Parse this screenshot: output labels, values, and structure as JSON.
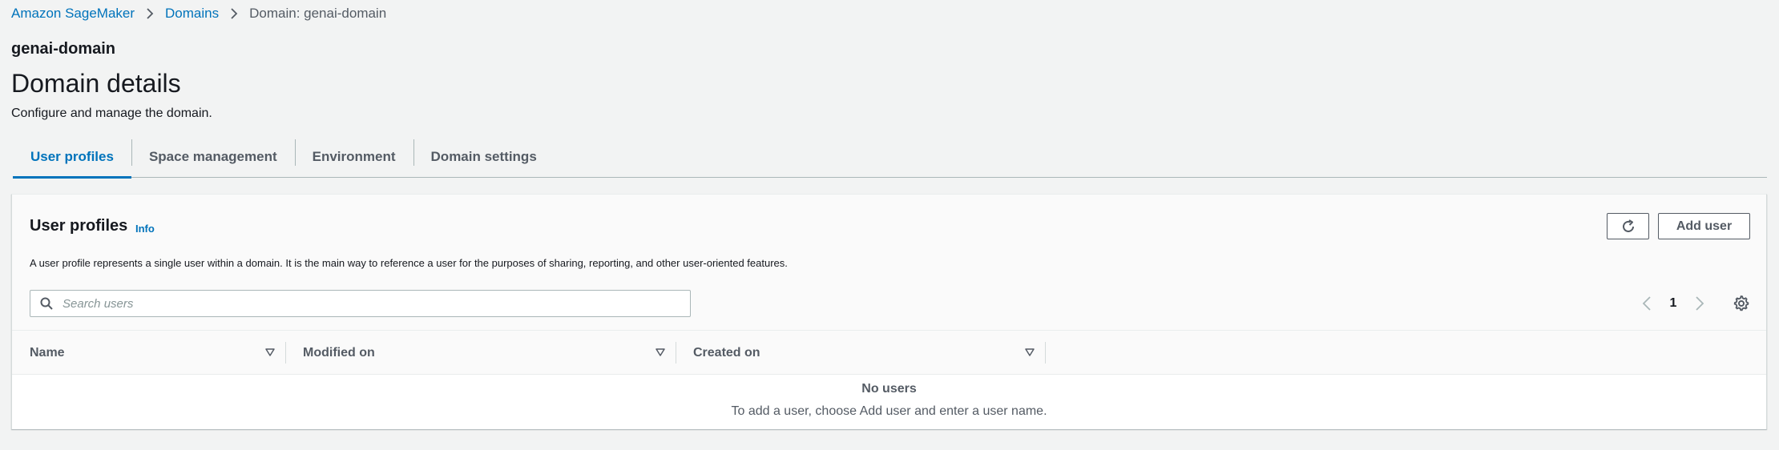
{
  "breadcrumb": {
    "items": [
      "Amazon SageMaker",
      "Domains"
    ],
    "current": "Domain: genai-domain"
  },
  "header": {
    "domain_name": "genai-domain",
    "title": "Domain details",
    "description": "Configure and manage the domain."
  },
  "tabs": [
    {
      "label": "User profiles",
      "active": true
    },
    {
      "label": "Space management",
      "active": false
    },
    {
      "label": "Environment",
      "active": false
    },
    {
      "label": "Domain settings",
      "active": false
    }
  ],
  "panel": {
    "title": "User profiles",
    "info_label": "Info",
    "description": "A user profile represents a single user within a domain. It is the main way to reference a user for the purposes of sharing, reporting, and other user-oriented features.",
    "refresh_icon": "refresh-icon",
    "add_user_label": "Add user",
    "search": {
      "placeholder": "Search users",
      "value": ""
    },
    "pagination": {
      "current_page": "1"
    },
    "table": {
      "columns": [
        "Name",
        "Modified on",
        "Created on"
      ],
      "rows": [],
      "empty_title": "No users",
      "empty_description": "To add a user, choose Add user and enter a user name."
    }
  },
  "colors": {
    "link": "#0073bb",
    "text": "#16191f",
    "muted": "#545b64",
    "background": "#f2f3f3"
  }
}
